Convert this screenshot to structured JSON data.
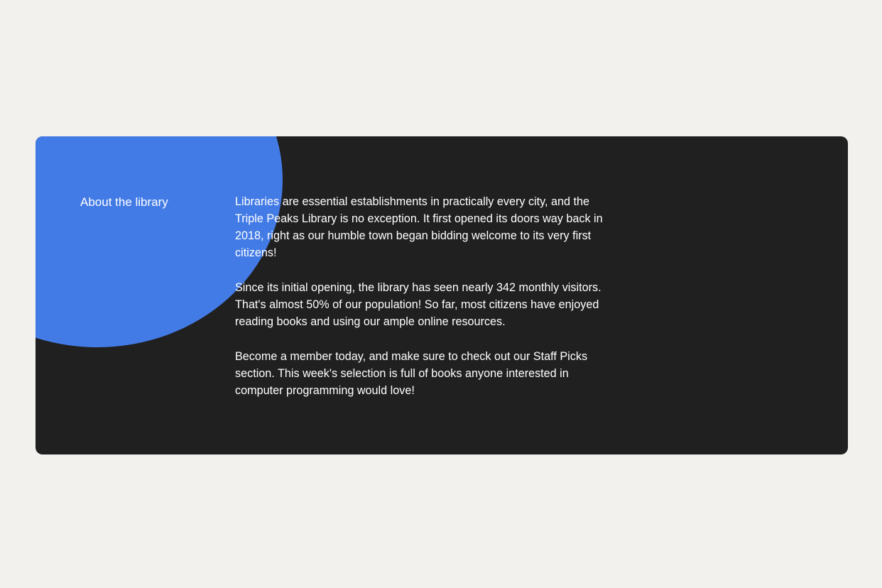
{
  "section": {
    "title": "About the library",
    "paragraphs": [
      "Libraries are essential establishments in practically every city, and the Triple Peaks Library is no exception. It first opened its doors way back in 2018, right as our humble town began bidding welcome to its very first citizens!",
      "Since its initial opening, the library has seen nearly 342 monthly visitors. That's almost 50% of our population! So far, most citizens have enjoyed reading books and using our ample online resources.",
      "Become a member today, and make sure to check out our Staff Picks section. This week's selection is full of books anyone interested in computer programming would love!"
    ]
  },
  "colors": {
    "page_background": "#f2f1ed",
    "card_background": "#202020",
    "accent_circle": "#437be6",
    "text": "#ffffff"
  }
}
